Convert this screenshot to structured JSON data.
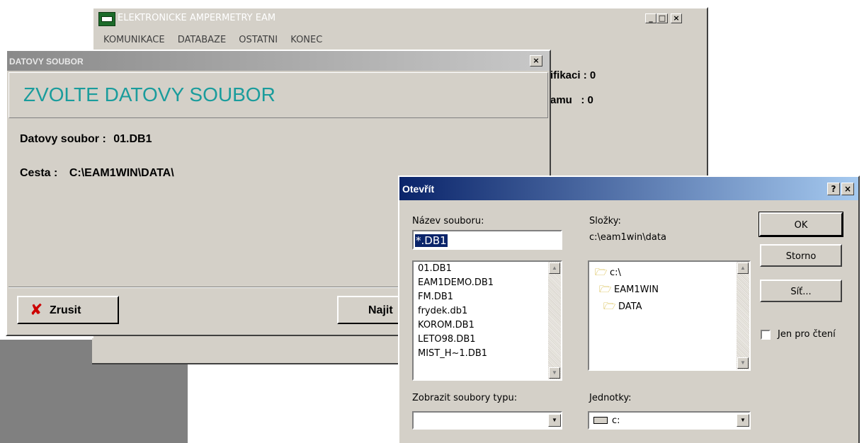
{
  "main_window": {
    "title": "ELEKTRONICKE AMPERMETRY EAM",
    "menu": [
      "KOMUNIKACE",
      "DATABAZE",
      "OSTATNI",
      "KONEC"
    ],
    "info_line1": "ifikaci : 0",
    "info_line2": "amu   : 0",
    "min_glyph": "_",
    "max_glyph": "□",
    "close_glyph": "×"
  },
  "datafile_dialog": {
    "title": "DATOVY SOUBOR",
    "close_glyph": "×",
    "heading": "ZVOLTE DATOVY SOUBOR",
    "file_label": "Datovy soubor :",
    "file_value": "01.DB1",
    "path_label": "Cesta :",
    "path_value": "C:\\EAM1WIN\\DATA\\",
    "cancel_label": "Zrusit",
    "find_label": "Najit"
  },
  "open_dialog": {
    "title": "Otevřít",
    "help_glyph": "?",
    "close_glyph": "×",
    "filename_label": "Název souboru:",
    "filename_value": "*.DB1",
    "files": [
      "01.DB1",
      "EAM1DEMO.DB1",
      "FM.DB1",
      "frydek.db1",
      "KOROM.DB1",
      "LETO98.DB1",
      "MIST_H~1.DB1"
    ],
    "folders_label": "Složky:",
    "current_path": "c:\\eam1win\\data",
    "folders": [
      "c:\\",
      "EAM1WIN",
      "DATA"
    ],
    "ok_label": "OK",
    "cancel_label": "Storno",
    "network_label": "Síť...",
    "readonly_label": "Jen pro čtení",
    "filetype_label": "Zobrazit soubory typu:",
    "filetype_value": "",
    "drives_label": "Jednotky:",
    "drive_value": "c:"
  },
  "colors": {
    "dialog_face": "#d4d0c8",
    "active_title_start": "#0a246a",
    "active_title_end": "#a6caf0",
    "inactive_title": "#808080",
    "heading_teal": "#1a9c9c"
  }
}
